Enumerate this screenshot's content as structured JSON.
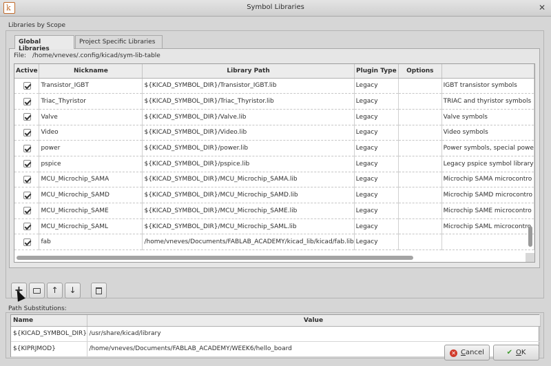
{
  "window": {
    "title": "Symbol Libraries",
    "app_icon_letter": "k"
  },
  "scope": {
    "label": "Libraries by Scope",
    "tabs": [
      {
        "label": "Global Libraries"
      },
      {
        "label": "Project Specific Libraries"
      }
    ],
    "file_label": "File:",
    "file_path": "/home/vneves/.config/kicad/sym-lib-table"
  },
  "libraries": {
    "headers": {
      "active": "Active",
      "nickname": "Nickname",
      "path": "Library Path",
      "plugin": "Plugin Type",
      "options": "Options",
      "description": ""
    },
    "rows": [
      {
        "active": true,
        "nickname": "Transistor_IGBT",
        "path": "${KICAD_SYMBOL_DIR}/Transistor_IGBT.lib",
        "plugin": "Legacy",
        "options": "",
        "description": "IGBT transistor symbols"
      },
      {
        "active": true,
        "nickname": "Triac_Thyristor",
        "path": "${KICAD_SYMBOL_DIR}/Triac_Thyristor.lib",
        "plugin": "Legacy",
        "options": "",
        "description": "TRIAC and thyristor symbols"
      },
      {
        "active": true,
        "nickname": "Valve",
        "path": "${KICAD_SYMBOL_DIR}/Valve.lib",
        "plugin": "Legacy",
        "options": "",
        "description": "Valve symbols"
      },
      {
        "active": true,
        "nickname": "Video",
        "path": "${KICAD_SYMBOL_DIR}/Video.lib",
        "plugin": "Legacy",
        "options": "",
        "description": "Video symbols"
      },
      {
        "active": true,
        "nickname": "power",
        "path": "${KICAD_SYMBOL_DIR}/power.lib",
        "plugin": "Legacy",
        "options": "",
        "description": "Power symbols, special powe"
      },
      {
        "active": true,
        "nickname": "pspice",
        "path": "${KICAD_SYMBOL_DIR}/pspice.lib",
        "plugin": "Legacy",
        "options": "",
        "description": "Legacy pspice symbol library"
      },
      {
        "active": true,
        "nickname": "MCU_Microchip_SAMA",
        "path": "${KICAD_SYMBOL_DIR}/MCU_Microchip_SAMA.lib",
        "plugin": "Legacy",
        "options": "",
        "description": "Microchip SAMA microcontro"
      },
      {
        "active": true,
        "nickname": "MCU_Microchip_SAMD",
        "path": "${KICAD_SYMBOL_DIR}/MCU_Microchip_SAMD.lib",
        "plugin": "Legacy",
        "options": "",
        "description": "Microchip SAMD microcontro"
      },
      {
        "active": true,
        "nickname": "MCU_Microchip_SAME",
        "path": "${KICAD_SYMBOL_DIR}/MCU_Microchip_SAME.lib",
        "plugin": "Legacy",
        "options": "",
        "description": "Microchip SAME microcontro"
      },
      {
        "active": true,
        "nickname": "MCU_Microchip_SAML",
        "path": "${KICAD_SYMBOL_DIR}/MCU_Microchip_SAML.lib",
        "plugin": "Legacy",
        "options": "",
        "description": "Microchip SAML microcontro"
      },
      {
        "active": true,
        "nickname": "fab",
        "path": "/home/vneves/Documents/FABLAB_ACADEMY/kicad_lib/kicad/fab.lib",
        "plugin": "Legacy",
        "options": "",
        "description": ""
      }
    ]
  },
  "toolbar": {
    "add_label": "+",
    "up_label": "↑",
    "down_label": "↓"
  },
  "substitutions": {
    "label": "Path Substitutions:",
    "headers": {
      "name": "Name",
      "value": "Value"
    },
    "rows": [
      {
        "name": "${KICAD_SYMBOL_DIR}",
        "value": "/usr/share/kicad/library"
      },
      {
        "name": "${KIPRJMOD}",
        "value": "/home/vneves/Documents/FABLAB_ACADEMY/WEEK6/hello_board"
      }
    ]
  },
  "buttons": {
    "cancel_prefix": "",
    "cancel_mnemonic": "C",
    "cancel_rest": "ancel",
    "ok_mnemonic": "O",
    "ok_rest": "K"
  }
}
